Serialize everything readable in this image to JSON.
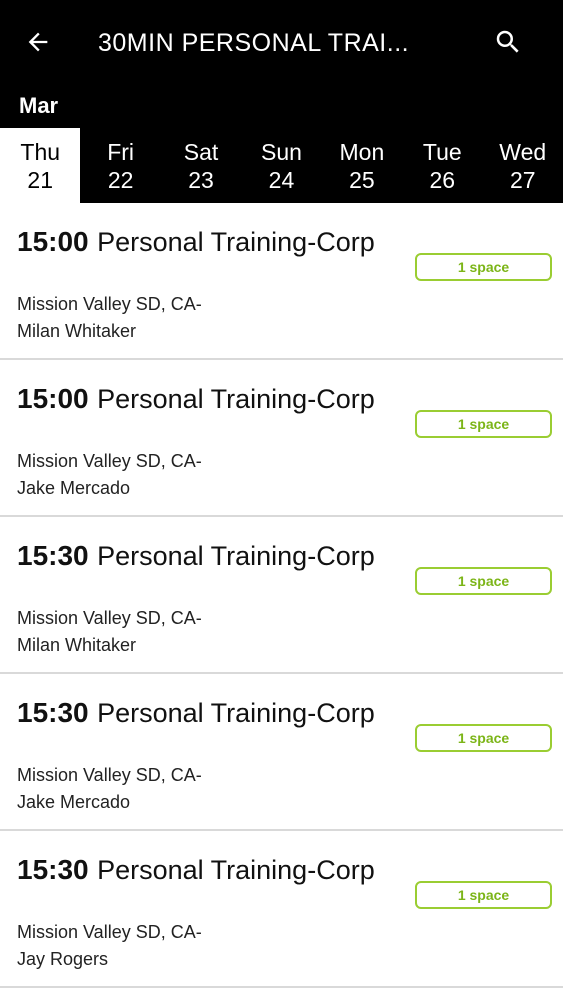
{
  "header": {
    "title": "30MIN PERSONAL TRAI...",
    "back_icon": "arrow-left-icon",
    "search_icon": "search-icon"
  },
  "calendar": {
    "month": "Mar",
    "selected_index": 0,
    "days": [
      {
        "name": "Thu",
        "num": "21"
      },
      {
        "name": "Fri",
        "num": "22"
      },
      {
        "name": "Sat",
        "num": "23"
      },
      {
        "name": "Sun",
        "num": "24"
      },
      {
        "name": "Mon",
        "num": "25"
      },
      {
        "name": "Tue",
        "num": "26"
      },
      {
        "name": "Wed",
        "num": "27"
      }
    ]
  },
  "sessions": [
    {
      "time": "15:00",
      "name": "Personal Training-Corp",
      "location": "Mission Valley SD, CA-",
      "trainer": "Milan Whitaker",
      "availability": "1 space"
    },
    {
      "time": "15:00",
      "name": "Personal Training-Corp",
      "location": "Mission Valley SD, CA-",
      "trainer": "Jake Mercado",
      "availability": "1 space"
    },
    {
      "time": "15:30",
      "name": "Personal Training-Corp",
      "location": "Mission Valley SD, CA-",
      "trainer": "Milan Whitaker",
      "availability": "1 space"
    },
    {
      "time": "15:30",
      "name": "Personal Training-Corp",
      "location": "Mission Valley SD, CA-",
      "trainer": "Jake Mercado",
      "availability": "1 space"
    },
    {
      "time": "15:30",
      "name": "Personal Training-Corp",
      "location": "Mission Valley SD, CA-",
      "trainer": "Jay Rogers",
      "availability": "1 space"
    }
  ],
  "colors": {
    "header_bg": "#000000",
    "accent_green": "#9acd32",
    "badge_text": "#7cb518",
    "divider": "#d9d9d9"
  }
}
